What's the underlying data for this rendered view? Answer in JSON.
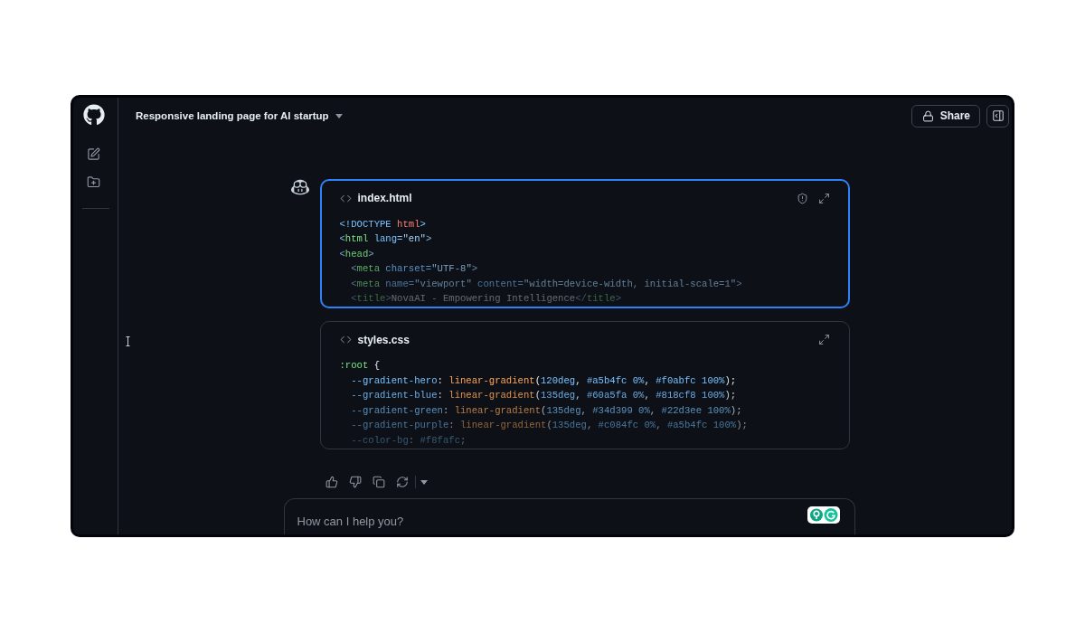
{
  "header": {
    "title": "Responsive landing page for AI startup",
    "share_label": "Share"
  },
  "response": {
    "code_blocks": [
      {
        "filename": "index.html",
        "focused": true,
        "lines": [
          {
            "tokens": [
              {
                "text": "<!DOCTYPE",
                "kind": "keyword"
              },
              {
                "text": " html",
                "kind": "name"
              },
              {
                "text": ">",
                "kind": "keyword"
              }
            ]
          },
          {
            "tokens": [
              {
                "text": "<",
                "kind": "punct"
              },
              {
                "text": "html",
                "kind": "tag"
              },
              {
                "text": " lang=",
                "kind": "attr"
              },
              {
                "text": "\"en\"",
                "kind": "string"
              },
              {
                "text": ">",
                "kind": "punct"
              }
            ]
          },
          {
            "tokens": [
              {
                "text": "<",
                "kind": "punct"
              },
              {
                "text": "head",
                "kind": "tag"
              },
              {
                "text": ">",
                "kind": "punct"
              }
            ]
          },
          {
            "tokens": [
              {
                "text": "  <",
                "kind": "punct"
              },
              {
                "text": "meta",
                "kind": "tag"
              },
              {
                "text": " charset=",
                "kind": "attr"
              },
              {
                "text": "\"UTF-8\"",
                "kind": "string"
              },
              {
                "text": ">",
                "kind": "punct"
              }
            ]
          },
          {
            "tokens": [
              {
                "text": "  <",
                "kind": "punct"
              },
              {
                "text": "meta",
                "kind": "tag"
              },
              {
                "text": " name=",
                "kind": "attr"
              },
              {
                "text": "\"viewport\"",
                "kind": "string"
              },
              {
                "text": " content=",
                "kind": "attr"
              },
              {
                "text": "\"width=device-width, initial-scale=1\"",
                "kind": "string"
              },
              {
                "text": ">",
                "kind": "punct"
              }
            ]
          },
          {
            "tokens": [
              {
                "text": "  <",
                "kind": "punct"
              },
              {
                "text": "title",
                "kind": "tag"
              },
              {
                "text": ">",
                "kind": "punct"
              },
              {
                "text": "NovaAI - Empowering Intelligence",
                "kind": "plain"
              },
              {
                "text": "</",
                "kind": "punct"
              },
              {
                "text": "title",
                "kind": "tag"
              },
              {
                "text": ">",
                "kind": "punct"
              }
            ]
          }
        ]
      },
      {
        "filename": "styles.css",
        "focused": false,
        "lines": [
          {
            "tokens": [
              {
                "text": ":root",
                "kind": "selector"
              },
              {
                "text": " {",
                "kind": "plain"
              }
            ]
          },
          {
            "tokens": [
              {
                "text": "  --gradient-hero",
                "kind": "property"
              },
              {
                "text": ": ",
                "kind": "plain"
              },
              {
                "text": "linear-gradient",
                "kind": "function"
              },
              {
                "text": "(",
                "kind": "plain"
              },
              {
                "text": "120deg",
                "kind": "number"
              },
              {
                "text": ", ",
                "kind": "plain"
              },
              {
                "text": "#a5b4fc 0%",
                "kind": "number"
              },
              {
                "text": ", ",
                "kind": "plain"
              },
              {
                "text": "#f0abfc 100%",
                "kind": "number"
              },
              {
                "text": ");",
                "kind": "plain"
              }
            ]
          },
          {
            "tokens": [
              {
                "text": "  --gradient-blue",
                "kind": "property"
              },
              {
                "text": ": ",
                "kind": "plain"
              },
              {
                "text": "linear-gradient",
                "kind": "function"
              },
              {
                "text": "(",
                "kind": "plain"
              },
              {
                "text": "135deg",
                "kind": "number"
              },
              {
                "text": ", ",
                "kind": "plain"
              },
              {
                "text": "#60a5fa 0%",
                "kind": "number"
              },
              {
                "text": ", ",
                "kind": "plain"
              },
              {
                "text": "#818cf8 100%",
                "kind": "number"
              },
              {
                "text": ");",
                "kind": "plain"
              }
            ]
          },
          {
            "tokens": [
              {
                "text": "  --gradient-green",
                "kind": "property"
              },
              {
                "text": ": ",
                "kind": "plain"
              },
              {
                "text": "linear-gradient",
                "kind": "function"
              },
              {
                "text": "(",
                "kind": "plain"
              },
              {
                "text": "135deg",
                "kind": "number"
              },
              {
                "text": ", ",
                "kind": "plain"
              },
              {
                "text": "#34d399 0%",
                "kind": "number"
              },
              {
                "text": ", ",
                "kind": "plain"
              },
              {
                "text": "#22d3ee 100%",
                "kind": "number"
              },
              {
                "text": ");",
                "kind": "plain"
              }
            ]
          },
          {
            "tokens": [
              {
                "text": "  --gradient-purple",
                "kind": "property"
              },
              {
                "text": ": ",
                "kind": "plain"
              },
              {
                "text": "linear-gradient",
                "kind": "function"
              },
              {
                "text": "(",
                "kind": "plain"
              },
              {
                "text": "135deg",
                "kind": "number"
              },
              {
                "text": ", ",
                "kind": "plain"
              },
              {
                "text": "#c084fc 0%",
                "kind": "number"
              },
              {
                "text": ", ",
                "kind": "plain"
              },
              {
                "text": "#a5b4fc 100%",
                "kind": "number"
              },
              {
                "text": ");",
                "kind": "plain"
              }
            ]
          },
          {
            "tokens": [
              {
                "text": "  --color-bg",
                "kind": "property"
              },
              {
                "text": ": ",
                "kind": "plain"
              },
              {
                "text": "#f8fafc",
                "kind": "number"
              },
              {
                "text": ";",
                "kind": "plain"
              }
            ]
          }
        ]
      }
    ]
  },
  "prompt": {
    "placeholder": "How can I help you?"
  }
}
